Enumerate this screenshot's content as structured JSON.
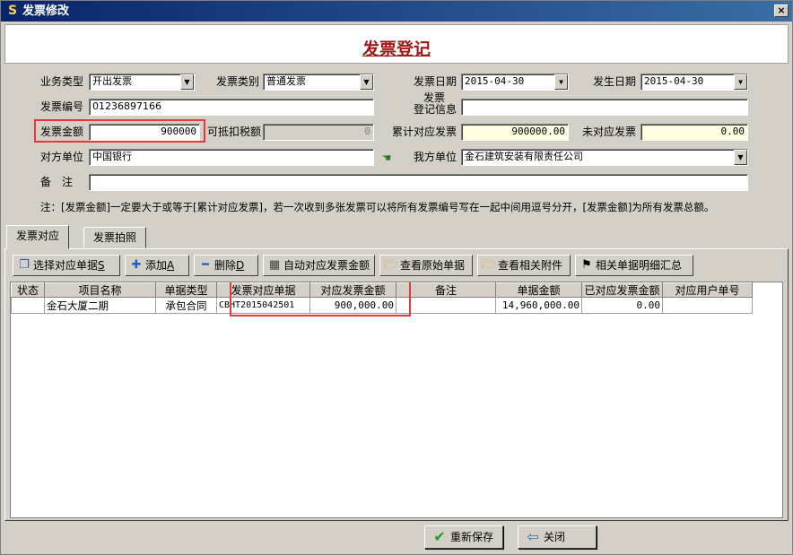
{
  "window": {
    "title": "发票修改",
    "close_glyph": "×",
    "app_icon_glyph": "S"
  },
  "header": {
    "title": "发票登记"
  },
  "form": {
    "business_type": {
      "label": "业务类型",
      "value": "开出发票"
    },
    "invoice_category": {
      "label": "发票类别",
      "value": "普通发票"
    },
    "invoice_date": {
      "label": "发票日期",
      "value": "2015-04-30"
    },
    "occurrence_date": {
      "label": "发生日期",
      "value": "2015-04-30"
    },
    "invoice_number": {
      "label": "发票编号",
      "value": "01236897166"
    },
    "registration_info": {
      "label_line1": "发票",
      "label_line2": "登记信息",
      "value": ""
    },
    "invoice_amount": {
      "label": "发票金额",
      "value": "900000"
    },
    "deductible_tax": {
      "label": "可抵扣税额",
      "value": "0"
    },
    "cumulative_matched": {
      "label": "累计对应发票",
      "value": "900000.00"
    },
    "unmatched": {
      "label": "未对应发票",
      "value": "0.00"
    },
    "counterparty": {
      "label": "对方单位",
      "value": "中国银行"
    },
    "our_unit": {
      "label": "我方单位",
      "value": "金石建筑安装有限责任公司"
    },
    "remarks": {
      "label": "备　注",
      "value": ""
    },
    "note": "注：[发票金额]一定要大于或等于[累计对应发票]，若一次收到多张发票可以将所有发票编号写在一起中间用逗号分开，[发票金额]为所有发票总额。"
  },
  "tabs": [
    {
      "label": "发票对应"
    },
    {
      "label": "发票拍照"
    }
  ],
  "toolbar": {
    "select_docs": "选择对应单据",
    "select_docs_key": "S",
    "add": "添加",
    "add_key": "A",
    "delete": "删除",
    "delete_key": "D",
    "auto_amount": "自动对应发票金额",
    "view_original": "查看原始单据",
    "view_attachments": "查看相关附件",
    "detail_summary": "相关单据明细汇总"
  },
  "grid": {
    "columns": [
      "状态",
      "项目名称",
      "单据类型",
      "发票对应单据",
      "对应发票金额",
      "备注",
      "单据金额",
      "已对应发票金额",
      "对应用户单号"
    ],
    "rows": [
      {
        "status": "",
        "project": "金石大厦二期",
        "doc_type": "承包合同",
        "doc_no": "CBHT2015042501",
        "amount": "900,000.00",
        "remark": "",
        "doc_amount": "14,960,000.00",
        "matched": "0.00",
        "user_no": ""
      }
    ]
  },
  "buttons": {
    "save": "重新保存",
    "close": "关闭"
  },
  "colors": {
    "title_red": "#a01818",
    "highlight_border": "#e23b3b",
    "field_yellow": "#ffffe1"
  }
}
